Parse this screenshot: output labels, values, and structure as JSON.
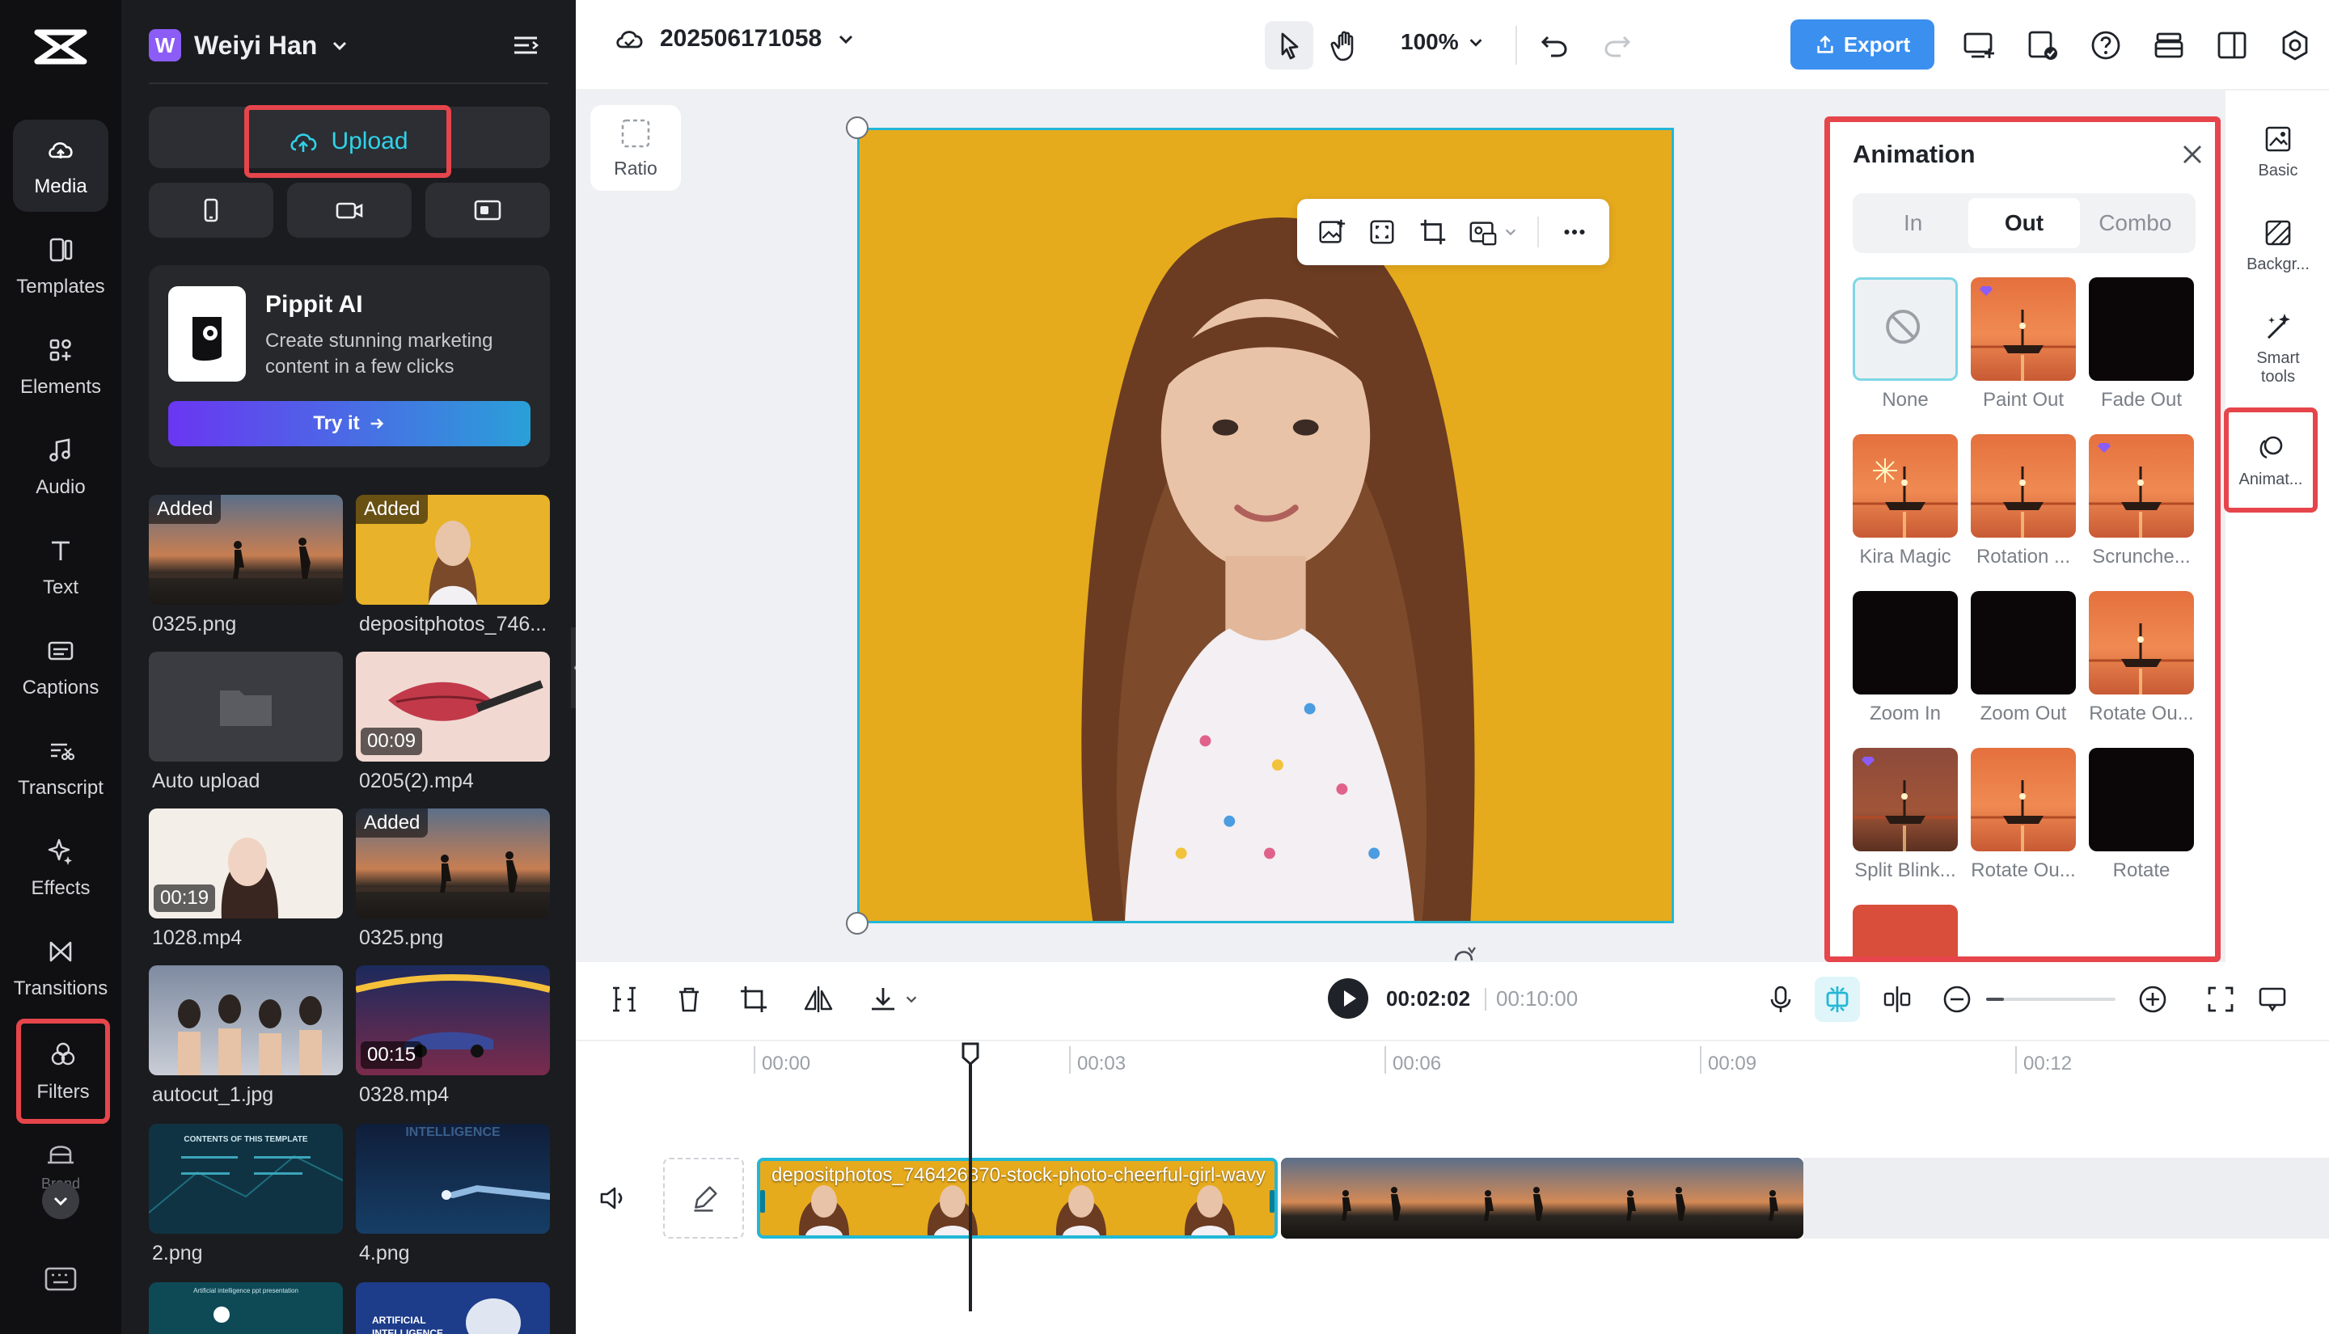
{
  "rail": {
    "items": [
      {
        "label": "Media",
        "icon": "media-cloud-icon",
        "active": true
      },
      {
        "label": "Templates",
        "icon": "templates-icon"
      },
      {
        "label": "Elements",
        "icon": "elements-icon"
      },
      {
        "label": "Audio",
        "icon": "audio-note-icon"
      },
      {
        "label": "Text",
        "icon": "text-icon"
      },
      {
        "label": "Captions",
        "icon": "captions-icon"
      },
      {
        "label": "Transcript",
        "icon": "transcript-icon"
      },
      {
        "label": "Effects",
        "icon": "effects-sparkle-icon"
      },
      {
        "label": "Transitions",
        "icon": "transitions-icon"
      },
      {
        "label": "Filters",
        "icon": "filters-icon"
      }
    ],
    "brand_label": "Brand"
  },
  "panel": {
    "user_name": "Weiyi Han",
    "avatar_letter": "W",
    "upload_label": "Upload",
    "pippit": {
      "title": "Pippit AI",
      "desc_line1": "Create stunning marketing",
      "desc_line2": "content in a few clicks",
      "cta": "Try it"
    },
    "media": [
      {
        "name": "0325.png",
        "tag": "Added",
        "duration": ""
      },
      {
        "name": "depositphotos_746...",
        "tag": "Added",
        "duration": ""
      },
      {
        "name": "Auto upload",
        "tag": "",
        "duration": ""
      },
      {
        "name": "0205(2).mp4",
        "tag": "",
        "duration": "00:09"
      },
      {
        "name": "1028.mp4",
        "tag": "",
        "duration": "00:19"
      },
      {
        "name": "0325.png",
        "tag": "Added",
        "duration": ""
      },
      {
        "name": "autocut_1.jpg",
        "tag": "",
        "duration": ""
      },
      {
        "name": "0328.mp4",
        "tag": "",
        "duration": "00:15"
      },
      {
        "name": "2.png",
        "tag": "",
        "duration": ""
      },
      {
        "name": "4.png",
        "tag": "",
        "duration": ""
      }
    ],
    "thumb_text": {
      "contents": "CONTENTS OF THIS TEMPLATE",
      "intelligence": "INTELLIGENCE",
      "ai_ppt": "Artificial intelligence ppt presentation",
      "artificial": "ARTIFICIAL",
      "intelligence2": "INTELLIGENCE"
    }
  },
  "topbar": {
    "project_name": "202506171058",
    "zoom": "100%",
    "export_label": "Export"
  },
  "canvas": {
    "ratio_label": "Ratio"
  },
  "animation": {
    "title": "Animation",
    "tabs": [
      "In",
      "Out",
      "Combo"
    ],
    "active_tab": "Out",
    "items": [
      {
        "label": "None",
        "style": "none"
      },
      {
        "label": "Paint Out",
        "style": "sunset",
        "premium": true
      },
      {
        "label": "Fade Out",
        "style": "dark"
      },
      {
        "label": "Kira Magic",
        "style": "sparkle"
      },
      {
        "label": "Rotation ...",
        "style": "sunset"
      },
      {
        "label": "Scrunche...",
        "style": "sunset",
        "premium": true
      },
      {
        "label": "Zoom In",
        "style": "dark"
      },
      {
        "label": "Zoom Out",
        "style": "dark"
      },
      {
        "label": "Rotate Ou...",
        "style": "sunset"
      },
      {
        "label": "Split Blink...",
        "style": "sunsetdim",
        "premium": true
      },
      {
        "label": "Rotate Ou...",
        "style": "sunset"
      },
      {
        "label": "Rotate",
        "style": "dark"
      }
    ]
  },
  "right_rail": {
    "items": [
      {
        "label": "Basic",
        "icon": "basic-image-icon"
      },
      {
        "label": "Backgr...",
        "icon": "background-icon"
      },
      {
        "label": "Smart tools",
        "icon": "smart-tools-wand-icon"
      },
      {
        "label": "Animat...",
        "icon": "animation-icon"
      }
    ]
  },
  "timeline": {
    "current_time": "00:02:02",
    "total_time": "00:10:00",
    "ticks": [
      "00:00",
      "00:03",
      "00:06",
      "00:09",
      "00:12"
    ],
    "clip_label": "depositphotos_746426870-stock-photo-cheerful-girl-wavy"
  },
  "colors": {
    "accent": "#3b8fef",
    "selection": "#22b7d6",
    "highlight": "#e5454b",
    "upload_text": "#2fd3e8"
  }
}
